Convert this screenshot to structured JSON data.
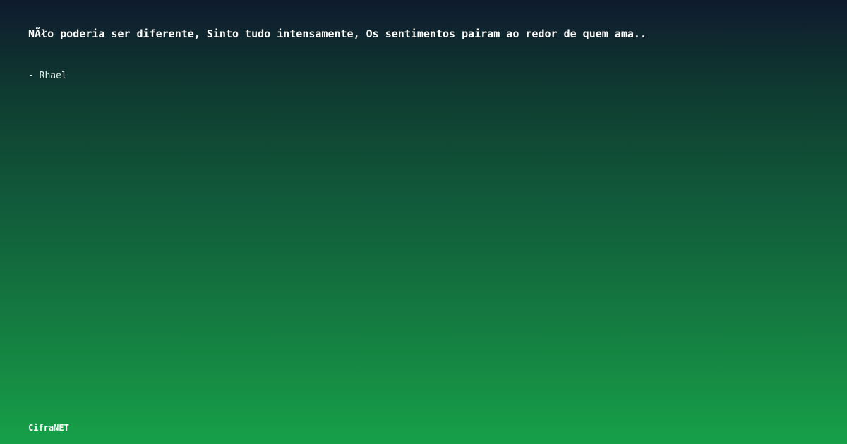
{
  "quote": {
    "text": "NÃło poderia ser diferente, Sinto tudo intensamente, Os sentimentos pairam ao redor de quem ama..",
    "author": "- Rhael"
  },
  "footer": {
    "brand": "CifraNET"
  }
}
